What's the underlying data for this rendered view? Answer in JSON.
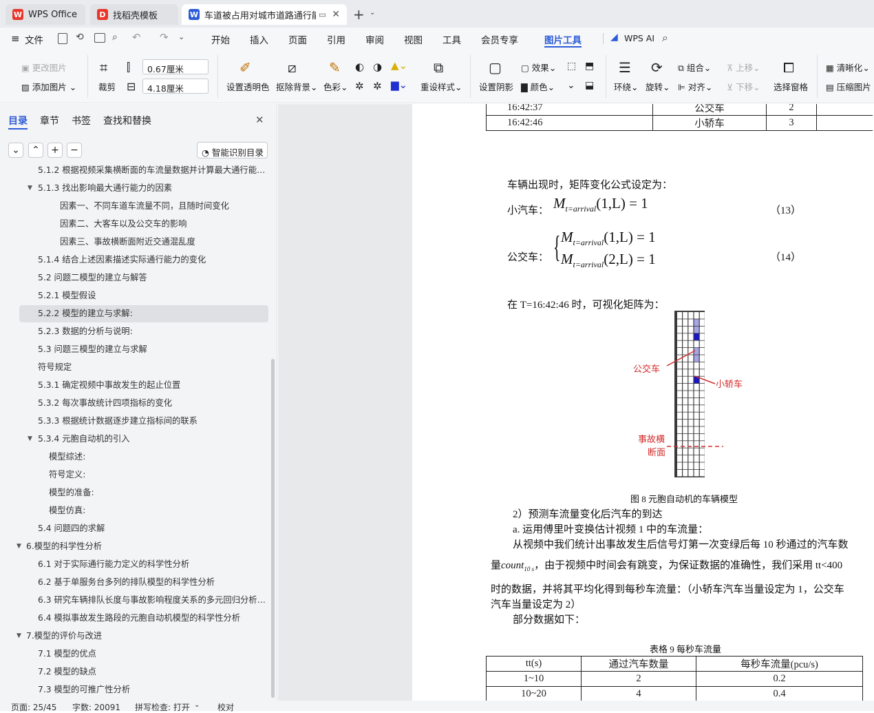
{
  "tabs": [
    {
      "label": "WPS Office",
      "icon": "wps-logo-icon"
    },
    {
      "label": "找稻壳模板",
      "icon": "docer-icon"
    },
    {
      "label": "车道被占用对城市道路通行能力",
      "icon": "word-doc-icon",
      "active": true
    }
  ],
  "menu": {
    "file": "文件",
    "items": [
      "开始",
      "插入",
      "页面",
      "引用",
      "审阅",
      "视图",
      "工具",
      "会员专享",
      "图片工具"
    ],
    "active": "图片工具",
    "wps_ai": "WPS AI"
  },
  "ribbon": {
    "change_picture": "更改图片",
    "add_picture": "添加图片",
    "crop": "裁剪",
    "width_value": "0.67厘米",
    "height_value": "4.18厘米",
    "set_transparent": "设置透明色",
    "remove_bg": "抠除背景",
    "color": "色彩",
    "reset_style": "重设样式",
    "shadow": "设置阴影",
    "effect": "效果",
    "fill_color": "颜色",
    "wrap": "环绕",
    "rotate": "旋转",
    "group": "组合",
    "align": "对齐",
    "bring_up": "上移",
    "send_down": "下移",
    "select_pane": "选择窗格",
    "sharpen": "清晰化",
    "compress": "压缩图片"
  },
  "sidebar": {
    "tabs": [
      "目录",
      "章节",
      "书签",
      "查找和替换"
    ],
    "active_tab": "目录",
    "smart_toc": "智能识别目录",
    "items": [
      {
        "text": "5.1.2 根据视频采集横断面的车流量数据并计算最大通行能…",
        "level": 2,
        "arrow": ""
      },
      {
        "text": "5.1.3 找出影响最大通行能力的因素",
        "level": 2,
        "arrow": "▼"
      },
      {
        "text": "因素一、不同车道车流量不同，且随时间变化",
        "level": 3,
        "arrow": ""
      },
      {
        "text": "因素二、大客车以及公交车的影响",
        "level": 3,
        "arrow": ""
      },
      {
        "text": "因素三、事故横断面附近交通混乱度",
        "level": 3,
        "arrow": ""
      },
      {
        "text": "5.1.4 结合上述因素描述实际通行能力的变化",
        "level": 2,
        "arrow": ""
      },
      {
        "text": "5.2 问题二模型的建立与解答",
        "level": 2,
        "arrow": ""
      },
      {
        "text": "5.2.1 模型假设",
        "level": 2,
        "arrow": ""
      },
      {
        "text": "5.2.2 模型的建立与求解:",
        "level": 2,
        "arrow": "",
        "selected": true
      },
      {
        "text": "5.2.3 数据的分析与说明:",
        "level": 2,
        "arrow": ""
      },
      {
        "text": "5.3 问题三模型的建立与求解",
        "level": 2,
        "arrow": ""
      },
      {
        "text": "符号规定",
        "level": 2,
        "arrow": ""
      },
      {
        "text": "5.3.1 确定视频中事故发生的起止位置",
        "level": 2,
        "arrow": ""
      },
      {
        "text": "5.3.2 每次事故统计四项指标的变化",
        "level": 2,
        "arrow": ""
      },
      {
        "text": "5.3.3 根据统计数据逐步建立指标间的联系",
        "level": 2,
        "arrow": ""
      },
      {
        "text": "5.3.4 元胞自动机的引入",
        "level": 2,
        "arrow": "▼"
      },
      {
        "text": "模型综述:",
        "level": 3,
        "arrow": ""
      },
      {
        "text": "符号定义:",
        "level": 3,
        "arrow": ""
      },
      {
        "text": "模型的准备:",
        "level": 3,
        "arrow": ""
      },
      {
        "text": "模型仿真:",
        "level": 3,
        "arrow": ""
      },
      {
        "text": "5.4 问题四的求解",
        "level": 2,
        "arrow": ""
      },
      {
        "text": "6.模型的科学性分析",
        "level": 1,
        "arrow": "▼"
      },
      {
        "text": "6.1 对于实际通行能力定义的科学性分析",
        "level": 2,
        "arrow": ""
      },
      {
        "text": "6.2 基于单服务台多列的排队模型的科学性分析",
        "level": 2,
        "arrow": ""
      },
      {
        "text": "6.3 研究车辆排队长度与事故影响程度关系的多元回归分析…",
        "level": 2,
        "arrow": ""
      },
      {
        "text": "6.4 模拟事故发生路段的元胞自动机模型的科学性分析",
        "level": 2,
        "arrow": ""
      },
      {
        "text": "7.模型的评价与改进",
        "level": 1,
        "arrow": "▼"
      },
      {
        "text": "7.1 模型的优点",
        "level": 2,
        "arrow": ""
      },
      {
        "text": "7.2 模型的缺点",
        "level": 2,
        "arrow": ""
      },
      {
        "text": "7.3 模型的可推广性分析",
        "level": 2,
        "arrow": ""
      }
    ]
  },
  "doc": {
    "top_table": [
      [
        "16:42:37",
        "公交车",
        "2"
      ],
      [
        "16:42:46",
        "小轿车",
        "3"
      ]
    ],
    "p_formula_intro": "车辆出现时，矩阵变化公式设定为：",
    "car_label": "小汽车：",
    "bus_label": "公交车：",
    "eq13_num": "（13）",
    "eq14_num": "（14）",
    "eq_m": "M",
    "eq_sub": "t=arrival",
    "eq13_args": "(1,L) = 1",
    "eq14_args_1": "(1,L) = 1",
    "eq14_args_2": "(2,L) = 1",
    "p_visual": "在 T=16:42:46 时，可视化矩阵为：",
    "fig_label_bus": "公交车",
    "fig_label_car": "小轿车",
    "fig_label_accident_1": "事故横",
    "fig_label_accident_2": "断面",
    "fig_caption": "图 8  元胞自动机的车辆模型",
    "p2": "2）预测车流量变化后汽车的到达",
    "pa": "a. 运用傅里叶变换估计视频 1 中的车流量：",
    "p_long1": "从视频中我们统计出事故发生后信号灯第一次变绿后每 10 秒通过的汽车数",
    "p_long2_a": "量",
    "p_long2_count": "count",
    "p_long2_sub": "10 s",
    "p_long2_b": "，由于视频中时间会有跳变，为保证数据的准确性，我们采用 tt<400",
    "p_long3": "时的数据，并将其平均化得到每秒车流量：（小轿车汽车当量设定为 1，公交车",
    "p_long4": "汽车当量设定为 2）",
    "p_partial": "部分数据如下：",
    "table9_caption": "表格  9  每秒车流量",
    "table9_headers": [
      "tt(s)",
      "通过汽车数量",
      "每秒车流量(pcu/s)"
    ],
    "table9_rows": [
      [
        "1~10",
        "2",
        "0.2"
      ],
      [
        "10~20",
        "4",
        "0.4"
      ]
    ]
  },
  "status": {
    "page": "页面: 25/45",
    "words": "字数: 20091",
    "spell": "拼写检查: 打开",
    "proof": "校对"
  },
  "colors": {
    "accent": "#2b5bd7",
    "annot": "#d12b2b",
    "car_blue": "#1a16c8",
    "bus_blue": "#a6a6e6"
  }
}
